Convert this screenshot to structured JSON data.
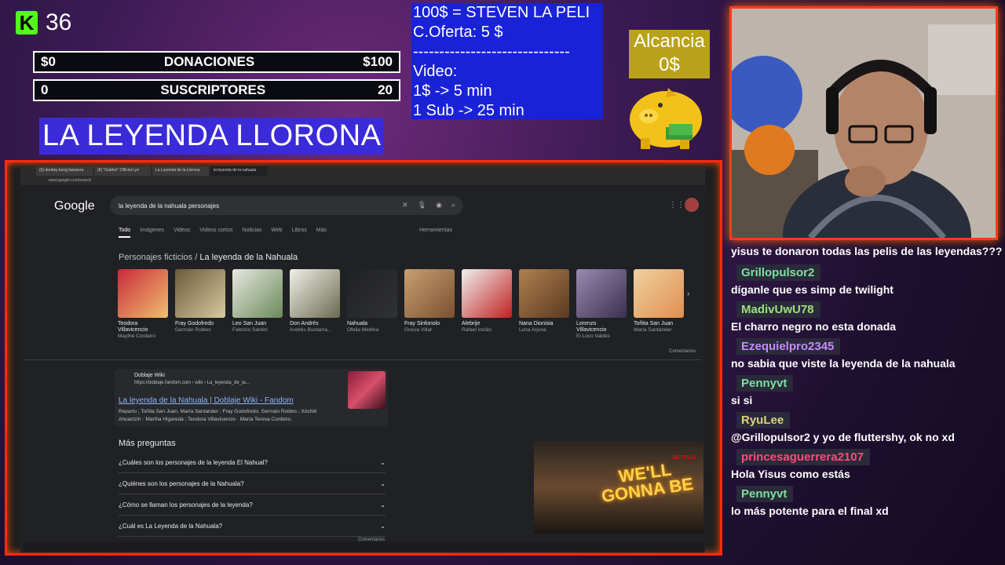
{
  "overlay": {
    "kick_viewers": "36",
    "donations": {
      "left": "$0",
      "label": "DONACIONES",
      "right": "$100"
    },
    "subs": {
      "left": "0",
      "label": "SUSCRIPTORES",
      "right": "20"
    },
    "stream_title": "LA LEYENDA LLORONA",
    "info_text": "100$ = STEVEN LA PELI\nC.Oferta: 5 $\n------------------------------\nVideo:\n1$ -> 5 min\n1 Sub -> 25 min",
    "alcancia_label": "Alcancia",
    "alcancia_value": "0$"
  },
  "chat": {
    "first_line": "yisus te donaron todas las pelis de las leyendas???",
    "messages": [
      {
        "user": "Grillopulsor2",
        "text": "díganle que es simp de twilight",
        "color": "#7ee0a0"
      },
      {
        "user": "MadivUwU78",
        "text": "El charro negro no esta donada",
        "color": "#9ee07e"
      },
      {
        "user": "Ezequielpro2345",
        "text": "no sabia que viste la leyenda de la nahuala",
        "color": "#c58aff"
      },
      {
        "user": "Pennyvt",
        "text": "si si",
        "color": "#7ee0a0"
      },
      {
        "user": "RyuLee",
        "text": "@Grillopulsor2 y yo de fluttershy, ok no xd",
        "color": "#e0d27e"
      },
      {
        "user": "princesaguerrera2107",
        "text": "Hola Yisus como estás",
        "color": "#ff4a7a"
      },
      {
        "user": "Pennyvt",
        "text": "lo más potente para el final xd",
        "color": "#7ee0a0"
      }
    ]
  },
  "browser": {
    "tabs": [
      "(9) donkey kong bananza",
      "(8) \"Golden\" Official Lyri",
      "La Leyenda de la Llorona",
      "la leyenda de la nahuala"
    ],
    "url": "www.google.com/search",
    "google": "Google",
    "query": "la leyenda de la nahuala personajes",
    "nav": [
      "Todo",
      "Imágenes",
      "Videos",
      "Videos cortos",
      "Noticias",
      "Web",
      "Libros",
      "Más"
    ],
    "herramientas": "Herramientas",
    "section_prefix": "Personajes ficticios / ",
    "section_title": "La leyenda de la Nahuala",
    "characters": [
      {
        "name": "Teodora Villavicencio",
        "actor": "Maythé Cordeiro",
        "c1": "#c82a3a",
        "c2": "#f0c070"
      },
      {
        "name": "Fray Godofredo",
        "actor": "Germán Robles",
        "c1": "#6a5a3a",
        "c2": "#d9c9a0"
      },
      {
        "name": "Leo San Juan",
        "actor": "Fabrizio Santini",
        "c1": "#e8e8e0",
        "c2": "#6a8a5a"
      },
      {
        "name": "Don Andrés",
        "actor": "Andrés Bustama...",
        "c1": "#f0f0e8",
        "c2": "#6a6a50"
      },
      {
        "name": "Nahuala",
        "actor": "Ofelia Medina",
        "c1": "#202124",
        "c2": "#303134"
      },
      {
        "name": "Fray Sinfonolo",
        "actor": "Grecia Villar",
        "c1": "#c8a070",
        "c2": "#7a5030"
      },
      {
        "name": "Alebrije",
        "actor": "Rafael Inclán",
        "c1": "#f0f0f0",
        "c2": "#c02020"
      },
      {
        "name": "Nana Dionisia",
        "actor": "Luna Arjona",
        "c1": "#b08050",
        "c2": "#5a3a20"
      },
      {
        "name": "Lorenzo Villavicencio",
        "actor": "El Loco Valdés",
        "c1": "#9a8ab0",
        "c2": "#3a3050"
      },
      {
        "name": "Toñita San Juan",
        "actor": "María Santander",
        "c1": "#f0d0a0",
        "c2": "#e09050"
      }
    ],
    "comentarios": "Comentarios",
    "result": {
      "site": "Doblaje Wiki",
      "url": "https://doblaje.fandom.com › wiki › La_leyenda_de_la...",
      "title": "La leyenda de la Nahuala | Doblaje Wiki - Fandom",
      "snippet": "Reparto ; Toñita San Juan, María Santander ; Fray Godofredo, Germán Robles ; Xóchitl Ahuactzin · Martha Higareda ; Teodora Villavicencio · María Teresa Cordeiro."
    },
    "mas_preguntas": "Más preguntas",
    "questions": [
      "¿Cuáles son los personajes de la leyenda El Nahual?",
      "¿Quiénes son los personajes de la Nahuala?",
      "¿Cómo se llaman los personajes de la leyenda?",
      "¿Cuál es La Leyenda de la Nahuala?"
    ],
    "video_text": "WE'LL GONNA BE",
    "netflix": "NETFLIX"
  }
}
